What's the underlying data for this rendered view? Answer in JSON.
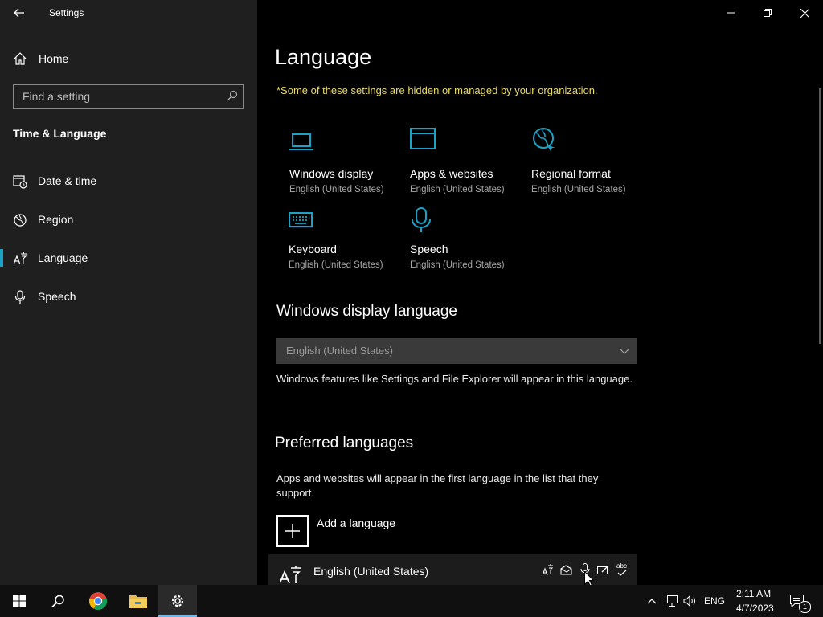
{
  "window": {
    "title": "Settings"
  },
  "sidebar": {
    "home_label": "Home",
    "search_placeholder": "Find a setting",
    "section_title": "Time & Language",
    "items": [
      {
        "label": "Date & time",
        "icon": "date-time-icon"
      },
      {
        "label": "Region",
        "icon": "globe-icon"
      },
      {
        "label": "Language",
        "icon": "language-icon",
        "selected": true
      },
      {
        "label": "Speech",
        "icon": "microphone-icon"
      }
    ]
  },
  "main": {
    "title": "Language",
    "org_note": "*Some of these settings are hidden or managed by your organization.",
    "tiles": [
      {
        "title": "Windows display",
        "subtitle": "English (United States)",
        "icon": "laptop-icon"
      },
      {
        "title": "Apps & websites",
        "subtitle": "English (United States)",
        "icon": "window-icon"
      },
      {
        "title": "Regional format",
        "subtitle": "English (United States)",
        "icon": "regional-format-icon"
      },
      {
        "title": "Keyboard",
        "subtitle": "English (United States)",
        "icon": "keyboard-icon"
      },
      {
        "title": "Speech",
        "subtitle": "English (United States)",
        "icon": "microphone-icon"
      }
    ],
    "display_language": {
      "heading": "Windows display language",
      "selected": "English (United States)",
      "description": "Windows features like Settings and File Explorer will appear in this language."
    },
    "preferred": {
      "heading": "Preferred languages",
      "description": "Apps and websites will appear in the first language in the list that they support.",
      "add_label": "Add a language",
      "languages": [
        {
          "label": "English (United States)"
        }
      ],
      "feature_abc": "abc"
    }
  },
  "taskbar": {
    "input_indicator": "ENG",
    "time": "2:11 AM",
    "date": "4/7/2023",
    "notification_count": "1"
  },
  "colors": {
    "accent": "#1aa3c7",
    "warning_text": "#e9d96a",
    "sidebar_bg": "#1f1f1f"
  }
}
